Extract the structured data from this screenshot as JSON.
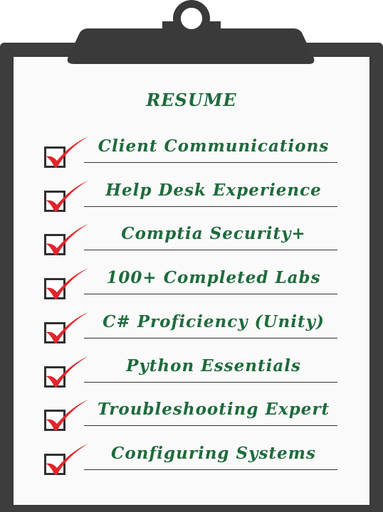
{
  "title": "RESUME",
  "colors": {
    "text": "#1e6b3c",
    "check": "#e0262b",
    "board": "#3d3d3d"
  },
  "items": [
    {
      "label": "Client Communications",
      "icon": "checkmark-icon"
    },
    {
      "label": "Help Desk Experience",
      "icon": "checkmark-icon"
    },
    {
      "label": "Comptia Security+",
      "icon": "checkmark-icon"
    },
    {
      "label": "100+ Completed Labs",
      "icon": "checkmark-icon"
    },
    {
      "label": "C# Proficiency (Unity)",
      "icon": "checkmark-icon"
    },
    {
      "label": "Python Essentials",
      "icon": "checkmark-icon"
    },
    {
      "label": "Troubleshooting Expert",
      "icon": "checkmark-icon"
    },
    {
      "label": "Configuring Systems",
      "icon": "checkmark-icon"
    }
  ]
}
